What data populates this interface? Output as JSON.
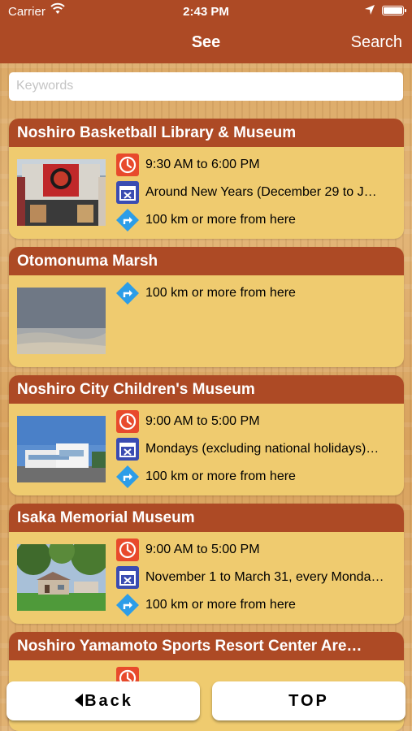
{
  "status_bar": {
    "carrier": "Carrier",
    "time": "2:43 PM"
  },
  "nav": {
    "title": "See",
    "search_label": "Search"
  },
  "search": {
    "placeholder": "Keywords",
    "value": ""
  },
  "cards": [
    {
      "title": "Noshiro Basketball Library & Museum",
      "rows": [
        {
          "icon": "clock-icon",
          "text": "9:30 AM to 6:00 PM"
        },
        {
          "icon": "calendar-closed-icon",
          "text": "Around New Years (December 29 to J…"
        },
        {
          "icon": "directions-icon",
          "text": "100 km or more from here"
        }
      ]
    },
    {
      "title": "Otomonuma Marsh",
      "rows": [
        {
          "icon": "directions-icon",
          "text": "100 km or more from here"
        }
      ]
    },
    {
      "title": "Noshiro City Children's Museum",
      "rows": [
        {
          "icon": "clock-icon",
          "text": "9:00 AM to 5:00 PM"
        },
        {
          "icon": "calendar-closed-icon",
          "text": "Mondays (excluding national holidays)…"
        },
        {
          "icon": "directions-icon",
          "text": "100 km or more from here"
        }
      ]
    },
    {
      "title": "Isaka Memorial Museum",
      "rows": [
        {
          "icon": "clock-icon",
          "text": "9:00 AM to 5:00 PM"
        },
        {
          "icon": "calendar-closed-icon",
          "text": "November 1 to March 31, every Monda…"
        },
        {
          "icon": "directions-icon",
          "text": "100 km or more from here"
        }
      ]
    },
    {
      "title": "Noshiro Yamamoto Sports Resort Center Are…",
      "rows": [
        {
          "icon": "clock-icon",
          "text": ""
        }
      ]
    }
  ],
  "buttons": {
    "back": "Back",
    "top": "TOP"
  },
  "colors": {
    "nav": "#ad4a25",
    "card": "#efcb6f",
    "clock": "#e84a2c",
    "calendar": "#3a4cb2",
    "directions": "#2c9de8"
  }
}
